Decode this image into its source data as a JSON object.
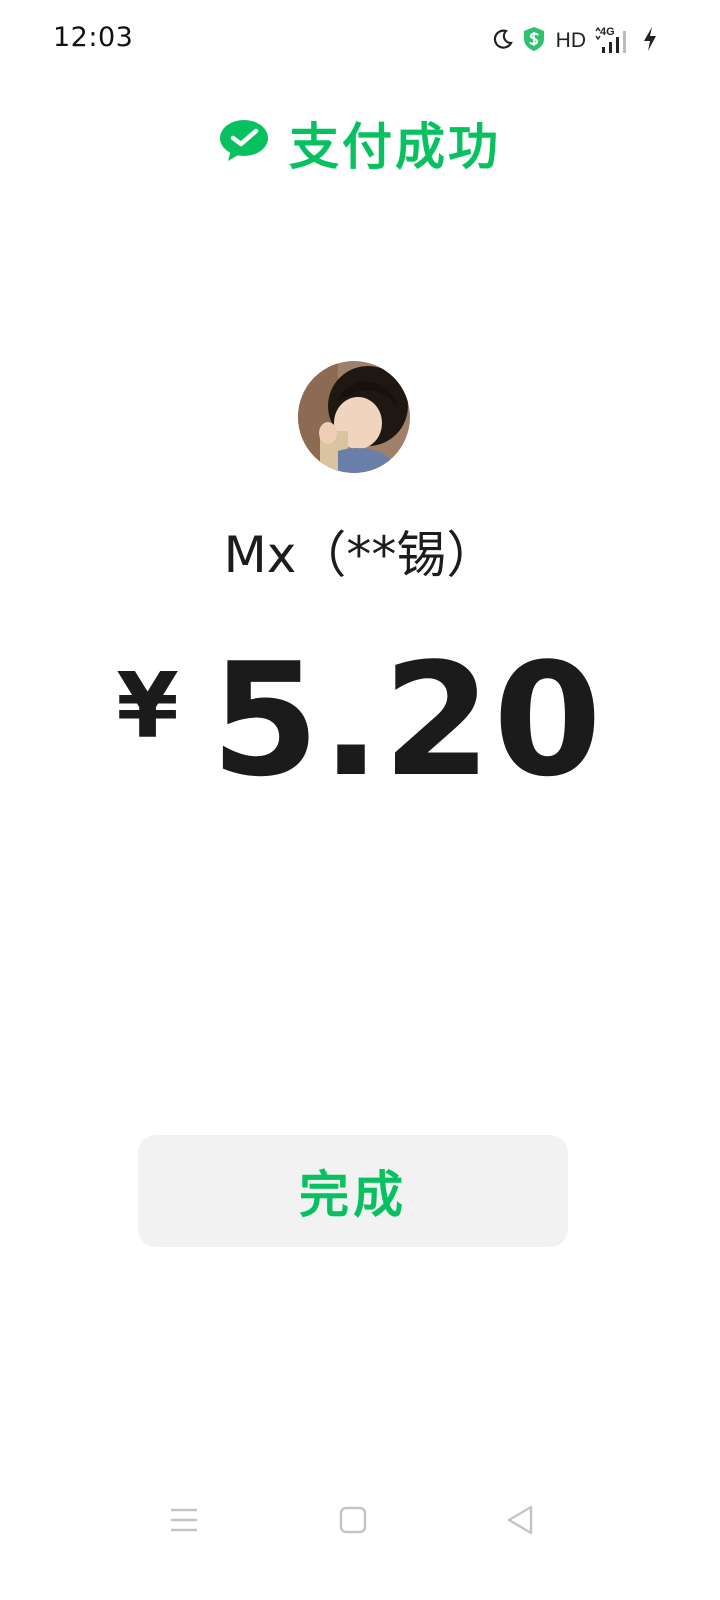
{
  "status_bar": {
    "time": "12:03",
    "hd_label": "HD",
    "network_label": "4G",
    "icons": [
      "moon-icon",
      "shield-icon",
      "hd-icon",
      "signal-icon",
      "charging-icon"
    ]
  },
  "header": {
    "title": "支付成功",
    "icon": "wechat-pay-icon"
  },
  "payee": {
    "name": "Mx（**锡）",
    "avatar": "avatar-photo"
  },
  "payment": {
    "currency": "¥",
    "amount": "5.20"
  },
  "actions": {
    "done_label": "完成"
  },
  "nav_bar": {
    "icons": [
      "menu-icon",
      "home-icon",
      "back-icon"
    ]
  },
  "colors": {
    "accent": "#07c160",
    "text": "#1b1b1b",
    "button_bg": "#f2f2f2"
  }
}
